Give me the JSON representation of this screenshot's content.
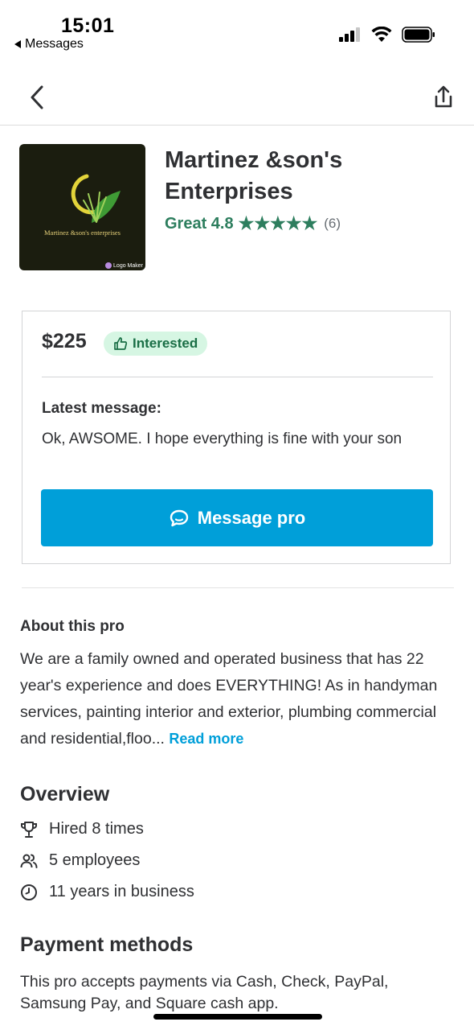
{
  "status_bar": {
    "time": "15:01",
    "back_app_label": "Messages"
  },
  "business": {
    "name": "Martinez &son's Enterprises",
    "logo_text": "Martinez  &son's  enterprises",
    "logo_watermark": "Logo Maker",
    "rating_label": "Great 4.8",
    "rating_value": 4.8,
    "stars": "★★★★★",
    "review_count": "(6)"
  },
  "quote": {
    "price": "$225",
    "badge": "Interested",
    "latest_label": "Latest message:",
    "latest_text": "Ok, AWSOME. I hope everything is fine with your son",
    "button_label": "Message pro"
  },
  "about": {
    "title": "About this pro",
    "text": "We are a family owned and operated business that has 22 year's experience and does EVERYTHING! As in handyman services, painting interior and exterior, plumbing commercial and residential,floo...",
    "read_more": "Read more"
  },
  "overview": {
    "title": "Overview",
    "items": [
      {
        "icon": "trophy-icon",
        "text": "Hired 8 times"
      },
      {
        "icon": "people-icon",
        "text": "5 employees"
      },
      {
        "icon": "clock-icon",
        "text": "11 years in business"
      }
    ]
  },
  "payment": {
    "title": "Payment methods",
    "text": "This pro accepts payments via Cash, Check, PayPal, Samsung Pay, and Square cash app."
  },
  "colors": {
    "accent": "#009fd9",
    "rating_green": "#2d7e5e",
    "badge_bg": "#d6f6e3",
    "badge_text": "#196e45"
  }
}
